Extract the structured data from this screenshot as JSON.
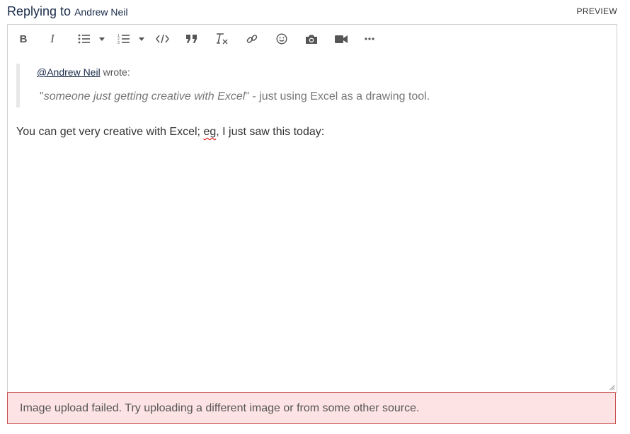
{
  "header": {
    "replying_label": "Replying to",
    "replying_name": "Andrew Neil",
    "preview_label": "PREVIEW"
  },
  "toolbar": {
    "bold": "B",
    "italic": "I",
    "icons": [
      "bold-icon",
      "italic-icon",
      "bulleted-list-icon",
      "numbered-list-icon",
      "code-icon",
      "quote-icon",
      "clear-format-icon",
      "link-icon",
      "emoji-icon",
      "camera-icon",
      "video-icon",
      "more-icon"
    ]
  },
  "quote": {
    "mention": "@Andrew Neil",
    "wrote": "wrote:",
    "open_quote": "\"",
    "quoted_italic": "someone just getting creative with Excel",
    "tail": "\" - just using Excel as a drawing tool."
  },
  "body": {
    "part1": "You can get very creative with Excel; ",
    "misspelled": "eg",
    "part2": ", I just saw this today:"
  },
  "error": {
    "message": "Image upload failed. Try uploading a different image or from some other source."
  },
  "colors": {
    "title": "#1a2b4a",
    "error_bg": "#fde3e3",
    "error_border": "#c85050",
    "spellcheck": "#dd0000"
  }
}
